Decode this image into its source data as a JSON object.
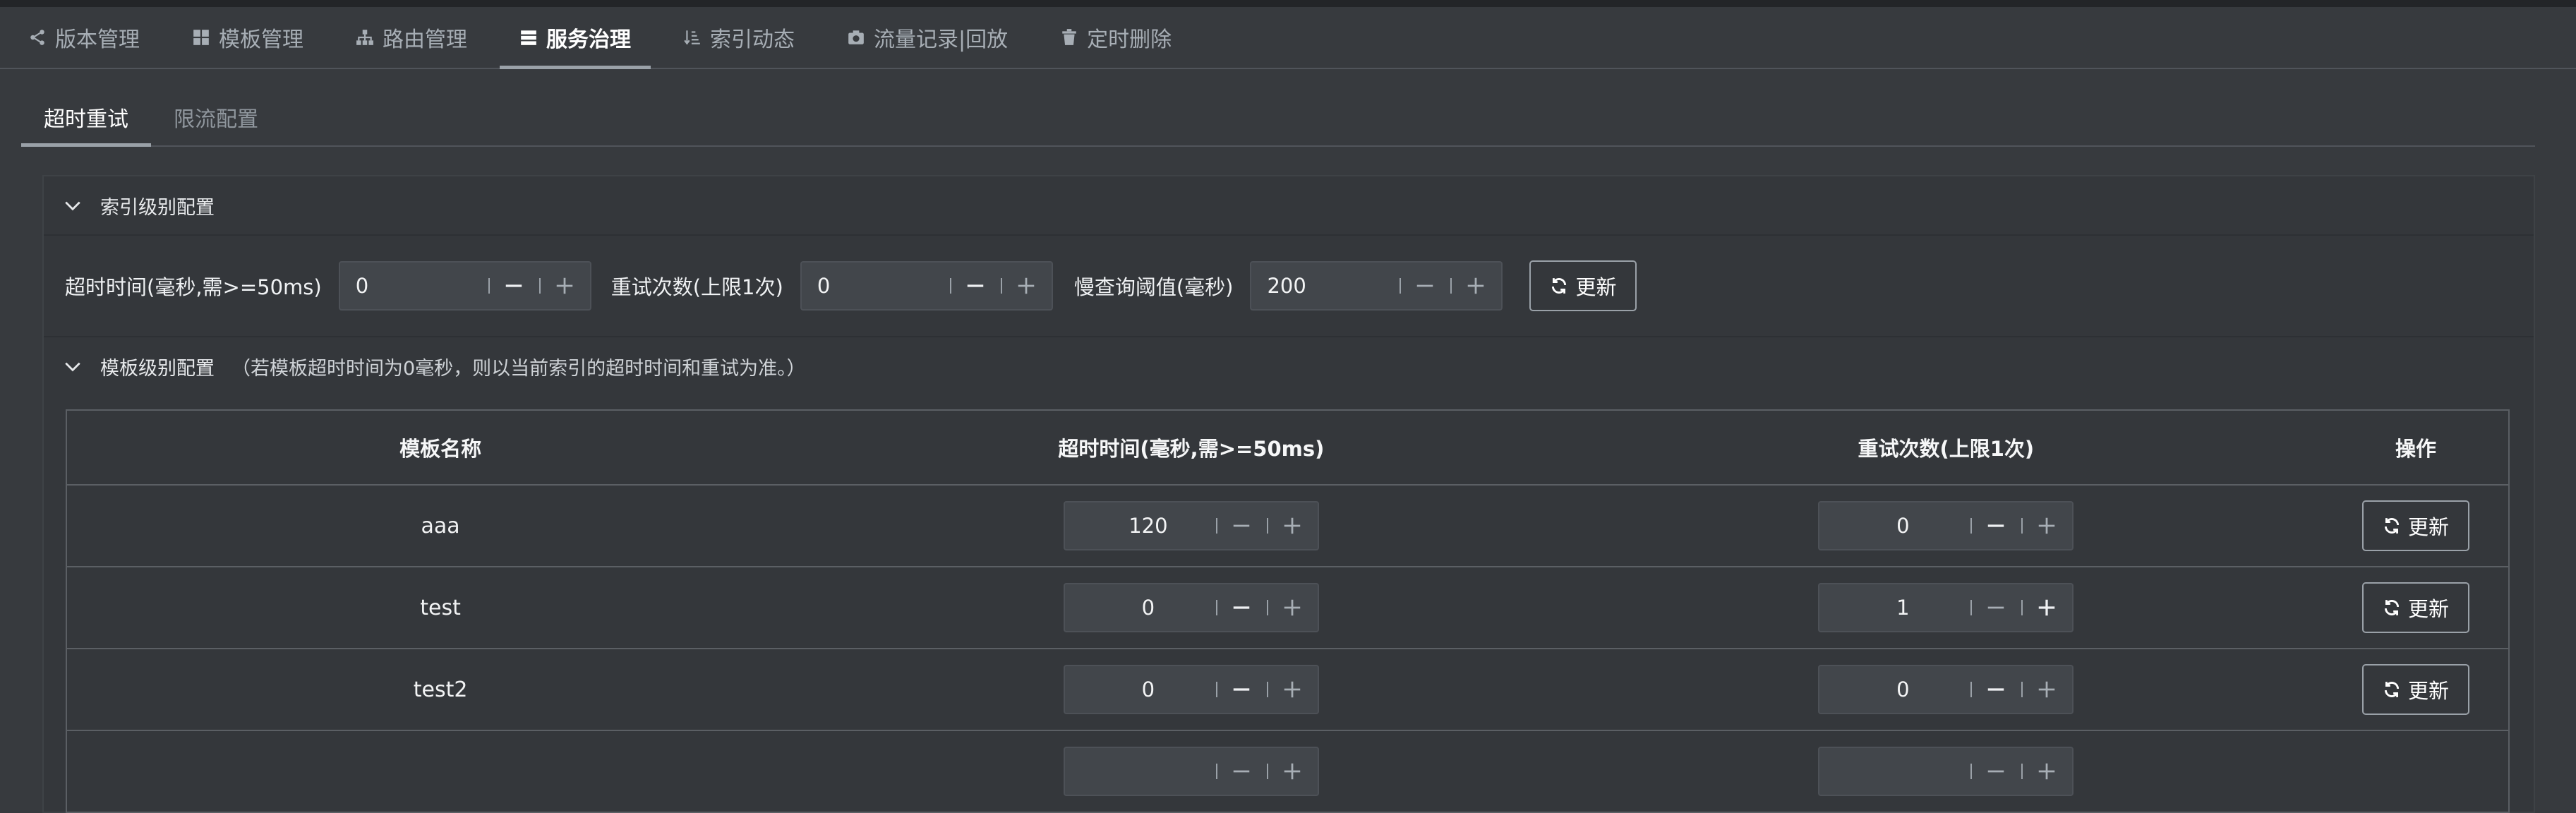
{
  "nav": {
    "tabs": [
      {
        "label": "版本管理",
        "icon": "share-icon"
      },
      {
        "label": "模板管理",
        "icon": "grid-icon"
      },
      {
        "label": "路由管理",
        "icon": "sitemap-icon"
      },
      {
        "label": "服务治理",
        "icon": "server-icon",
        "active": true
      },
      {
        "label": "索引动态",
        "icon": "sort-icon"
      },
      {
        "label": "流量记录|回放",
        "icon": "camera-icon"
      },
      {
        "label": "定时删除",
        "icon": "trash-icon"
      }
    ]
  },
  "subtabs": [
    {
      "label": "超时重试",
      "active": true
    },
    {
      "label": "限流配置"
    }
  ],
  "index_section": {
    "title": "索引级别配置",
    "timeout_label": "超时时间(毫秒,需>=50ms)",
    "timeout_value": "0",
    "retry_label": "重试次数(上限1次)",
    "retry_value": "0",
    "slow_label": "慢查询阈值(毫秒)",
    "slow_value": "200",
    "refresh_label": "更新"
  },
  "template_section": {
    "title": "模板级别配置",
    "note": "（若模板超时时间为0毫秒，则以当前索引的超时时间和重试为准。）",
    "columns": [
      "模板名称",
      "超时时间(毫秒,需>=50ms)",
      "重试次数(上限1次)",
      "操作"
    ],
    "rows": [
      {
        "name": "aaa",
        "timeout": "120",
        "retry": "0",
        "action": "更新"
      },
      {
        "name": "test",
        "timeout": "0",
        "retry": "1",
        "action": "更新"
      },
      {
        "name": "test2",
        "timeout": "0",
        "retry": "0",
        "action": "更新"
      }
    ]
  }
}
